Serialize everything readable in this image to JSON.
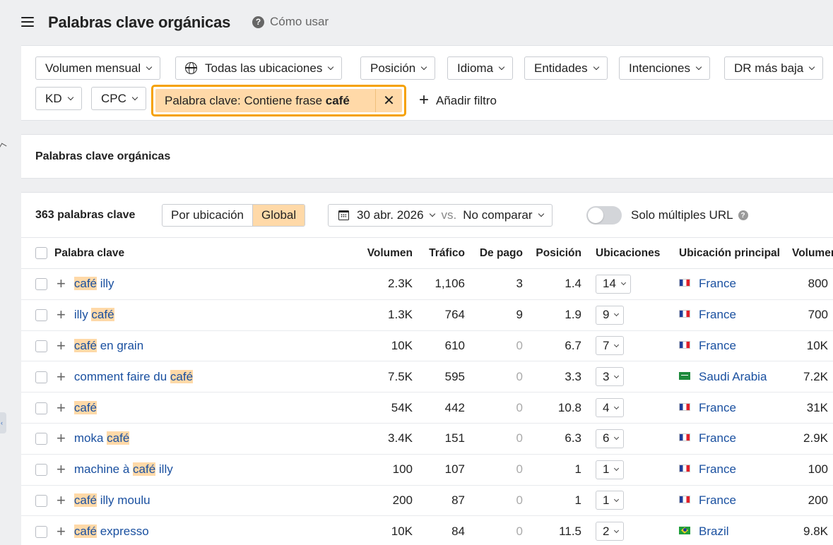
{
  "header": {
    "title": "Palabras clave orgánicas",
    "help_label": "Cómo usar"
  },
  "filters": {
    "buttons": [
      "Volumen mensual",
      "Todas las ubicaciones",
      "Posición",
      "Idioma",
      "Entidades",
      "Intenciones",
      "DR más baja",
      "KD",
      "CPC"
    ],
    "active": {
      "prefix": "Palabra clave: Contiene frase ",
      "term": "café",
      "highlight_color": "#f5a100"
    },
    "add_label": "Añadir filtro"
  },
  "section": {
    "title": "Palabras clave orgánicas"
  },
  "toolbar": {
    "count": "363 palabras clave",
    "segment_by_location": "Por ubicación",
    "segment_global": "Global",
    "date": "30 abr. 2026",
    "vs": "vs.",
    "compare": "No comparar",
    "toggle_label": "Solo múltiples URL",
    "toggle_on": false
  },
  "table": {
    "columns": [
      "Palabra clave",
      "Volumen",
      "Tráfico",
      "De pago",
      "Posición",
      "Ubicaciones",
      "Ubicación principal",
      "Volumen"
    ],
    "rows": [
      {
        "kw_pre": "",
        "kw_hl": "café",
        "kw_post": " illy",
        "volume": "2.3K",
        "traffic": "1,106",
        "paid": "3",
        "position": "1.4",
        "locations": "14",
        "country": "France",
        "flag": "fr",
        "volume2": "800"
      },
      {
        "kw_pre": "illy ",
        "kw_hl": "café",
        "kw_post": "",
        "volume": "1.3K",
        "traffic": "764",
        "paid": "9",
        "position": "1.9",
        "locations": "9",
        "country": "France",
        "flag": "fr",
        "volume2": "700"
      },
      {
        "kw_pre": "",
        "kw_hl": "café",
        "kw_post": " en grain",
        "volume": "10K",
        "traffic": "610",
        "paid": "0",
        "position": "6.7",
        "locations": "7",
        "country": "France",
        "flag": "fr",
        "volume2": "10K"
      },
      {
        "kw_pre": "comment faire du ",
        "kw_hl": "café",
        "kw_post": "",
        "volume": "7.5K",
        "traffic": "595",
        "paid": "0",
        "position": "3.3",
        "locations": "3",
        "country": "Saudi Arabia",
        "flag": "sa",
        "volume2": "7.2K"
      },
      {
        "kw_pre": "",
        "kw_hl": "café",
        "kw_post": "",
        "volume": "54K",
        "traffic": "442",
        "paid": "0",
        "position": "10.8",
        "locations": "4",
        "country": "France",
        "flag": "fr",
        "volume2": "31K"
      },
      {
        "kw_pre": "moka ",
        "kw_hl": "café",
        "kw_post": "",
        "volume": "3.4K",
        "traffic": "151",
        "paid": "0",
        "position": "6.3",
        "locations": "6",
        "country": "France",
        "flag": "fr",
        "volume2": "2.9K"
      },
      {
        "kw_pre": "machine à ",
        "kw_hl": "café",
        "kw_post": " illy",
        "volume": "100",
        "traffic": "107",
        "paid": "0",
        "position": "1",
        "locations": "1",
        "country": "France",
        "flag": "fr",
        "volume2": "100"
      },
      {
        "kw_pre": "",
        "kw_hl": "café",
        "kw_post": " illy moulu",
        "volume": "200",
        "traffic": "87",
        "paid": "0",
        "position": "1",
        "locations": "1",
        "country": "France",
        "flag": "fr",
        "volume2": "200"
      },
      {
        "kw_pre": "",
        "kw_hl": "café",
        "kw_post": " expresso",
        "volume": "10K",
        "traffic": "84",
        "paid": "0",
        "position": "11.5",
        "locations": "2",
        "country": "Brazil",
        "flag": "br",
        "volume2": "9.8K"
      }
    ]
  }
}
